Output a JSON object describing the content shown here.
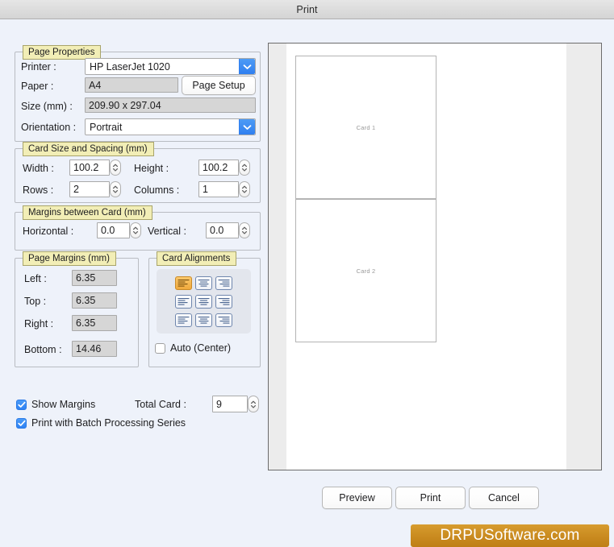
{
  "window": {
    "title": "Print"
  },
  "page_properties": {
    "legend": "Page Properties",
    "printer_label": "Printer :",
    "printer_value": "HP LaserJet 1020",
    "paper_label": "Paper :",
    "paper_value": "A4",
    "page_setup_label": "Page Setup",
    "size_label": "Size (mm) :",
    "size_value": "209.90 x 297.04",
    "orientation_label": "Orientation :",
    "orientation_value": "Portrait"
  },
  "card_size": {
    "legend": "Card Size and Spacing (mm)",
    "width_label": "Width :",
    "width_value": "100.2",
    "height_label": "Height :",
    "height_value": "100.2",
    "rows_label": "Rows :",
    "rows_value": "2",
    "columns_label": "Columns :",
    "columns_value": "1"
  },
  "margins_between_card": {
    "legend": "Margins between Card (mm)",
    "horizontal_label": "Horizontal :",
    "horizontal_value": "0.0",
    "vertical_label": "Vertical :",
    "vertical_value": "0.0"
  },
  "page_margins": {
    "legend": "Page Margins (mm)",
    "left_label": "Left :",
    "left_value": "6.35",
    "top_label": "Top :",
    "top_value": "6.35",
    "right_label": "Right :",
    "right_value": "6.35",
    "bottom_label": "Bottom :",
    "bottom_value": "14.46"
  },
  "card_alignments": {
    "legend": "Card Alignments",
    "auto_center_label": "Auto (Center)",
    "auto_center_checked": false,
    "selected_index": 0,
    "buttons": [
      {
        "name": "align-top-left",
        "h": "left",
        "v": "top",
        "selected": true
      },
      {
        "name": "align-top-center",
        "h": "center",
        "v": "top",
        "selected": false
      },
      {
        "name": "align-top-right",
        "h": "right",
        "v": "top",
        "selected": false
      },
      {
        "name": "align-middle-left",
        "h": "left",
        "v": "middle",
        "selected": false
      },
      {
        "name": "align-middle-center",
        "h": "center",
        "v": "middle",
        "selected": false
      },
      {
        "name": "align-middle-right",
        "h": "right",
        "v": "middle",
        "selected": false
      },
      {
        "name": "align-bottom-left",
        "h": "left",
        "v": "bottom",
        "selected": false
      },
      {
        "name": "align-bottom-center",
        "h": "center",
        "v": "bottom",
        "selected": false
      },
      {
        "name": "align-bottom-right",
        "h": "right",
        "v": "bottom",
        "selected": false
      }
    ]
  },
  "options": {
    "show_margins_label": "Show Margins",
    "show_margins_checked": true,
    "batch_label": "Print with Batch Processing Series",
    "batch_checked": true,
    "total_card_label": "Total Card :",
    "total_card_value": "9"
  },
  "preview": {
    "cards": [
      {
        "label": "Card 1"
      },
      {
        "label": "Card 2"
      }
    ]
  },
  "actions": {
    "preview_label": "Preview",
    "print_label": "Print",
    "cancel_label": "Cancel"
  },
  "watermark": {
    "text": "DRPUSoftware.com",
    "color": "#c98a1f"
  }
}
